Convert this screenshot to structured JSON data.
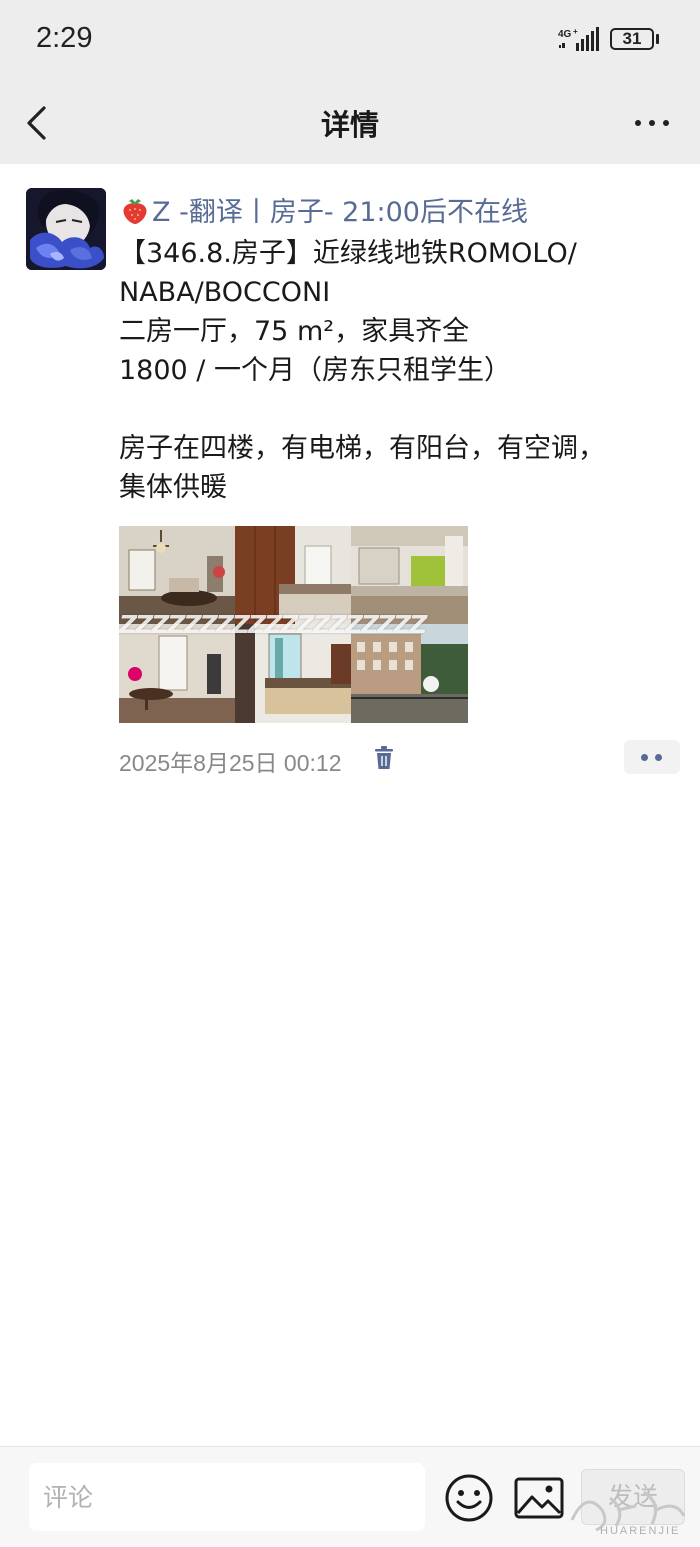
{
  "status_bar": {
    "time": "2:29",
    "network": "4G",
    "battery": "31"
  },
  "header": {
    "title": "详情"
  },
  "post": {
    "author_name": "Z -翻译丨房子- 21:00后不在线",
    "lines": [
      "【346.8.房子】近绿线地铁ROMOLO/",
      "NABA/BOCCONI",
      "二房一厅，75 m²，家具齐全",
      "1800 / 一个月（房东只租学生）",
      "",
      "房子在四楼，有电梯，有阳台，有空调，",
      "集体供暖"
    ],
    "photo_watermark": "ZZZZZZZZZZZZZZZZZZZ",
    "timestamp": "2025年8月25日 00:12"
  },
  "comment_bar": {
    "placeholder": "评论",
    "send_label": "发送"
  },
  "site_watermark": "HUARENJIE",
  "colors": {
    "link": "#576b95",
    "header_bg": "#ededed",
    "time_gray": "#888888"
  },
  "icons": [
    "back-arrow-icon",
    "more-dots-icon",
    "strawberry-icon",
    "trash-icon",
    "comment-dots-icon",
    "emoji-icon",
    "image-icon"
  ]
}
